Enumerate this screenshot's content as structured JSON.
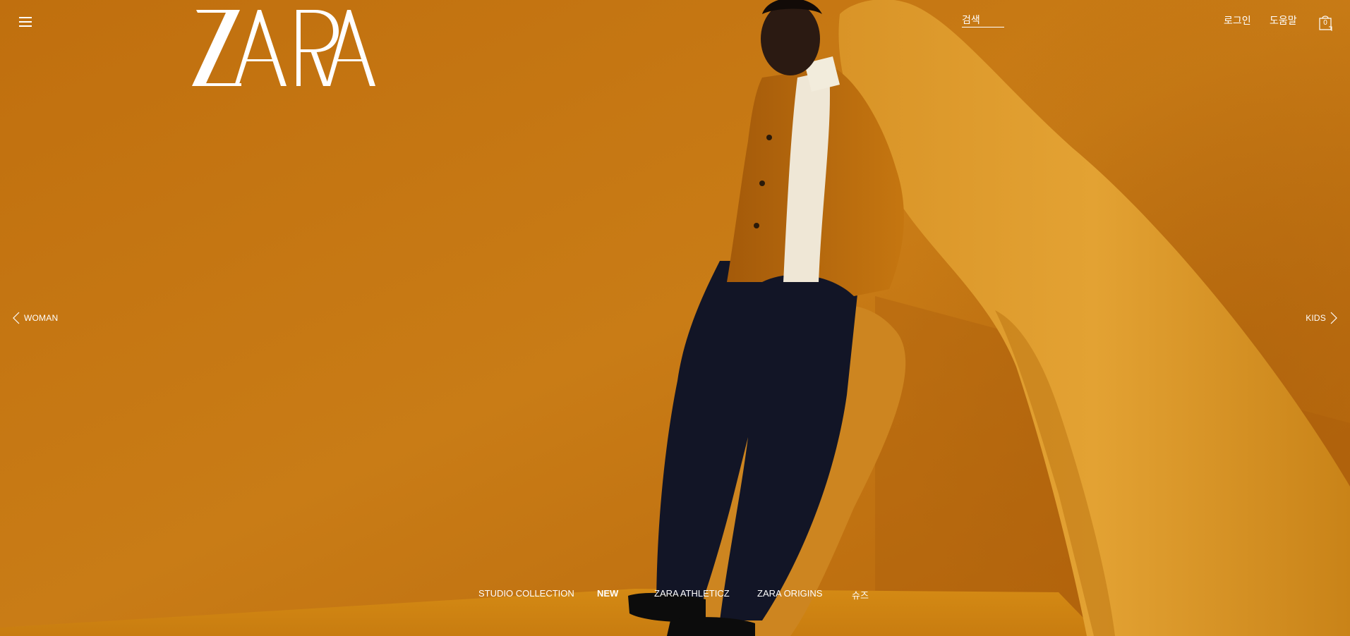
{
  "header": {
    "logo_text": "ZARA",
    "search_label": "검색",
    "login_label": "로그인",
    "help_label": "도움말",
    "cart_count": "0"
  },
  "side_nav": {
    "prev_label": "WOMAN",
    "next_label": "KIDS"
  },
  "bottom_nav": {
    "items": [
      {
        "label": "STUDIO COLLECTION",
        "active": false
      },
      {
        "label": "NEW",
        "active": true
      },
      {
        "label": "ZARA ATHLETICZ",
        "active": false
      },
      {
        "label": "ZARA ORIGINS",
        "active": false
      },
      {
        "label": "슈즈",
        "active": false
      }
    ]
  },
  "theme": {
    "background": "#c77a14",
    "text": "#ffffff"
  },
  "icons": [
    "hamburger-menu-icon",
    "shopping-bag-icon",
    "chevron-left-icon",
    "chevron-right-icon"
  ]
}
